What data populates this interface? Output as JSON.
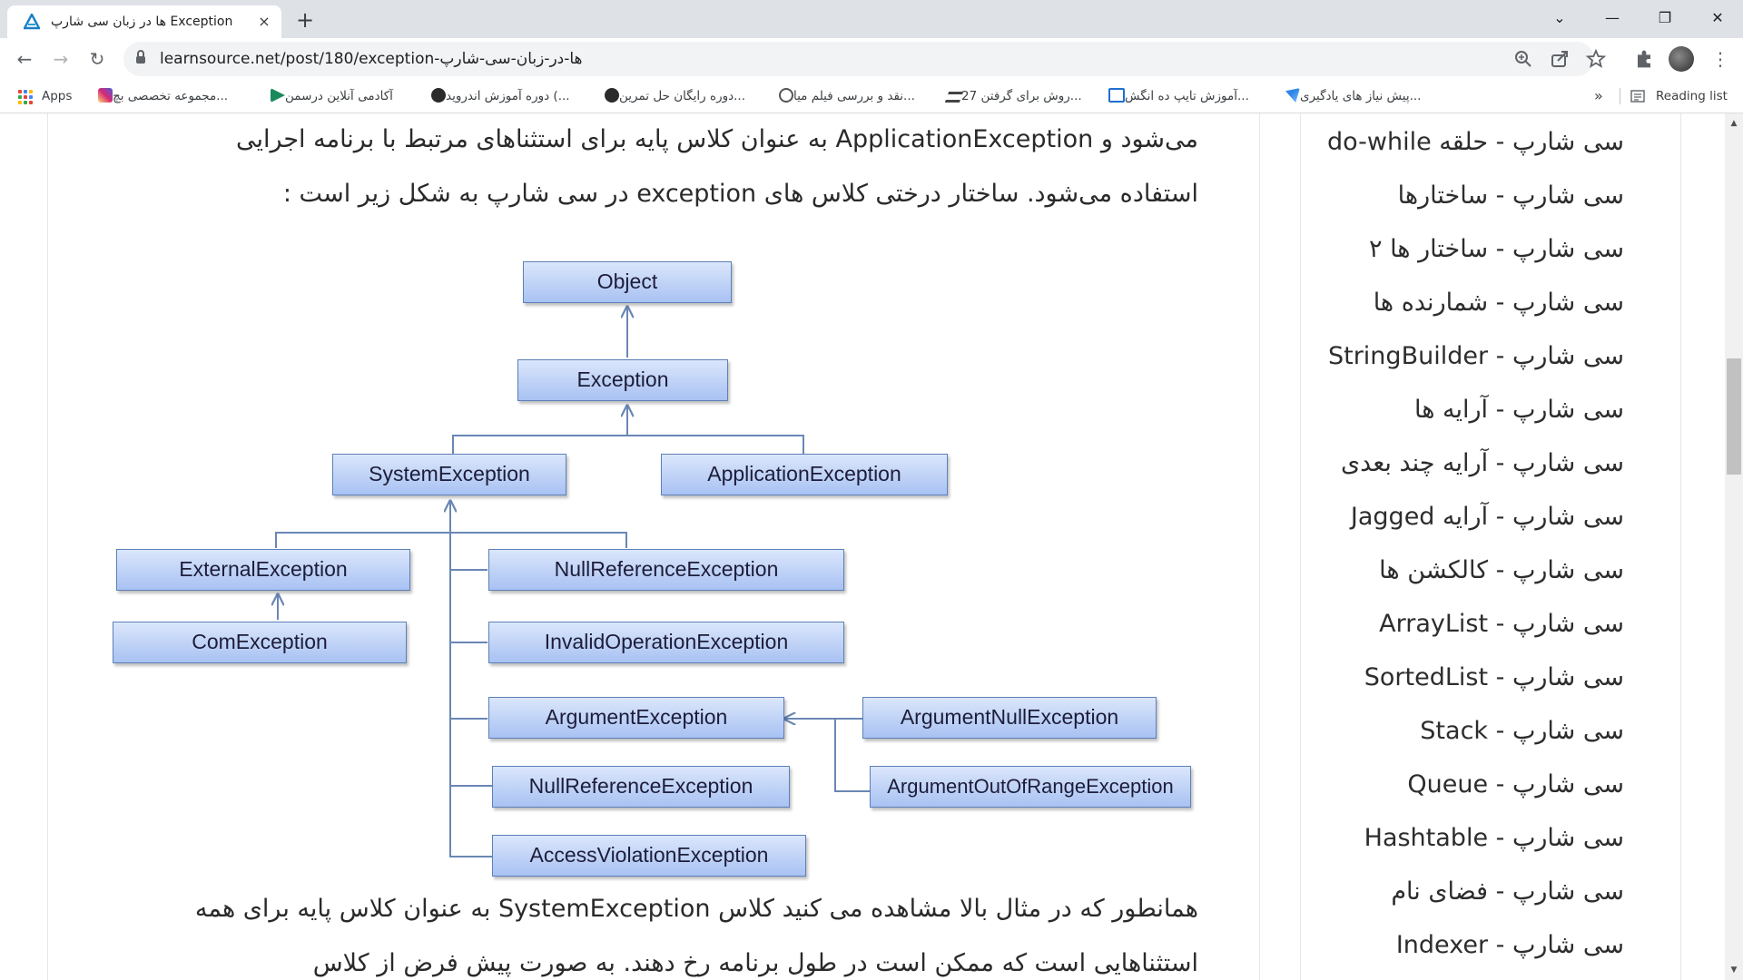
{
  "tab": {
    "title": "Exception ها در زبان سی شارپ",
    "close": "×",
    "new": "+"
  },
  "window": {
    "chevron": "⌄",
    "minimize": "—",
    "restore": "❐",
    "close": "✕"
  },
  "toolbar": {
    "back": "←",
    "forward": "→",
    "reload": "↻",
    "url": "learnsource.net/post/180/exception-ها-در-زبان-سی-شارپ",
    "menu": "⋮"
  },
  "bookmarks": {
    "apps": "Apps",
    "items": [
      {
        "label": "مجموعه تخصصی بچ...",
        "icon": "instagram-icon",
        "color": "#d62976"
      },
      {
        "label": "آکادمی آنلاین درسمن",
        "icon": "darsman-icon",
        "color": "#1a8a5a"
      },
      {
        "label": "دوره آموزش اندروید (...",
        "icon": "dark-circle-icon",
        "color": "#2b2b2b"
      },
      {
        "label": "دوره رایگان حل تمرین...",
        "icon": "dark-circle-icon",
        "color": "#2b2b2b"
      },
      {
        "label": "نقد و بررسی فیلم میا...",
        "icon": "film-icon",
        "color": "#555555"
      },
      {
        "label": "27 روش برای گرفتن...",
        "icon": "wing-icon",
        "color": "#444444"
      },
      {
        "label": "آموزش تایپ ده انگش...",
        "icon": "typing-icon",
        "color": "#1f6fd1"
      },
      {
        "label": "پیش نیاز های یادگیری...",
        "icon": "blue-logo-icon",
        "color": "#2f86e8"
      }
    ],
    "more": "»",
    "reading_list": "Reading list"
  },
  "article": {
    "line1": "می‌شود و ApplicationException به عنوان کلاس پایه برای استثناهای مرتبط با برنامه اجرایی",
    "line2": "استفاده می‌شود. ساختار درختی کلاس های exception در سی شارپ  به شکل زیر است :",
    "line3": "همانطور که در مثال بالا مشاهده می کنید کلاس SystemException به عنوان کلاس پایه برای  همه",
    "line4": "استثناهایی است که ممکن است در طول برنامه رخ دهند. به صورت پیش فرض از کلاس"
  },
  "diagram": {
    "object": "Object",
    "exception": "Exception",
    "system_exception": "SystemException",
    "application_exception": "ApplicationException",
    "external_exception": "ExternalException",
    "com_exception": "ComException",
    "null_reference_1": "NullReferenceException",
    "invalid_operation": "InvalidOperationException",
    "argument_exception": "ArgumentException",
    "argument_null": "ArgumentNullException",
    "null_reference_2": "NullReferenceException",
    "argument_out_of_range": "ArgumentOutOfRangeException",
    "access_violation": "AccessViolationException",
    "box_gradient_top": "#dbe6fb",
    "box_gradient_bottom": "#a8c2f3",
    "line_color": "#6a87b5"
  },
  "sidebar": {
    "items": [
      "سی شارپ - حلقه do-while",
      "سی شارپ - ساختارها",
      "سی شارپ - ساختار ها ۲",
      "سی شارپ - شمارنده ها",
      "سی شارپ - StringBuilder",
      "سی شارپ - آرایه ها",
      "سی شارپ - آرایه چند بعدی",
      "سی شارپ - آرایه Jagged",
      "سی شارپ - کالکشن ها",
      "سی شارپ - ArrayList",
      "سی شارپ - SortedList",
      "سی شارپ - Stack",
      "سی شارپ - Queue",
      "سی شارپ - Hashtable",
      "سی شارپ - فضای نام",
      "سی شارپ - Indexer"
    ]
  }
}
